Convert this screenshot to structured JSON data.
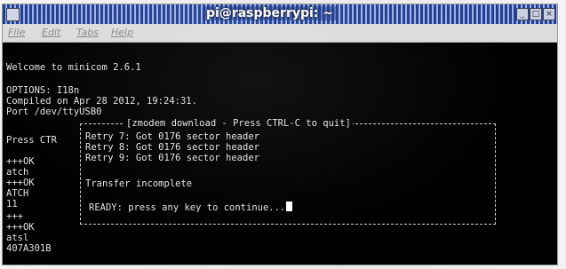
{
  "window": {
    "title": "pi@raspberrypi: ~"
  },
  "menu": [
    "File",
    "Edit",
    "Tabs",
    "Help"
  ],
  "terminal": {
    "lines": [
      "Welcome to minicom 2.6.1",
      "OPTIONS: I18n",
      "Compiled on Apr 28 2012, 19:24:31.",
      "Port /dev/ttyUSB0",
      "Press CTR",
      "+++OK",
      "atch",
      "+++OK",
      "ATCH",
      "11",
      "+++",
      "+++OK",
      "atsl",
      "407A301B"
    ]
  },
  "dialog": {
    "title": "[zmodem download - Press CTRL-C to quit]",
    "lines": [
      "Retry 7: Got 0176 sector header",
      "Retry 8: Got 0176 sector header",
      "Retry 9: Got 0176 sector header",
      "Transfer incomplete",
      "READY: press any key to continue..."
    ]
  },
  "colors": {
    "titlebar": "#1f3f95",
    "terminal_bg": "#000000",
    "terminal_fg": "#e2e2e2",
    "menubar": "#dcdcdc"
  },
  "icons": [
    "window-menu-icon",
    "minimize-icon",
    "maximize-icon",
    "close-icon",
    "cursor-block-icon"
  ]
}
